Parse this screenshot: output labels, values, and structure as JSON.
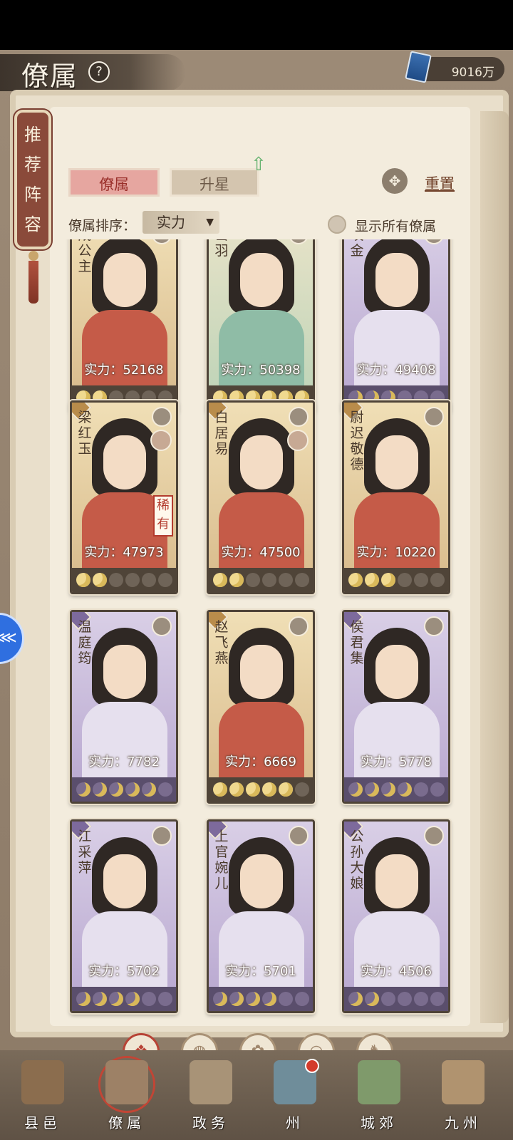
{
  "header": {
    "title": "僚属",
    "help_label": "?",
    "currency_value": "9016万",
    "currency_icon": "book-icon"
  },
  "recommend": {
    "label": "推荐阵容"
  },
  "tabs": [
    {
      "label": "僚属",
      "active": true
    },
    {
      "label": "升星",
      "active": false
    }
  ],
  "reset_label": "重置",
  "sort": {
    "label": "僚属排序：",
    "value": "实力"
  },
  "show_all_label": "显示所有僚属",
  "cards": [
    {
      "name": "成公主",
      "power_text": "实力：52168",
      "power": 52168,
      "frame": "gold",
      "stars_on": 2,
      "stars_total": 6
    },
    {
      "name": "岳羽",
      "power_text": "实力：50398",
      "power": 50398,
      "frame": "green",
      "stars_on": 6,
      "stars_total": 6
    },
    {
      "name": "咬金",
      "power_text": "实力：49408",
      "power": 49408,
      "frame": "purple",
      "stars_on": 3,
      "stars_total": 6
    },
    {
      "name": "梁红玉",
      "power_text": "实力：47973",
      "power": 47973,
      "frame": "gold",
      "stars_on": 2,
      "stars_total": 6,
      "rare": "稀有"
    },
    {
      "name": "白居易",
      "power_text": "实力：47500",
      "power": 47500,
      "frame": "gold",
      "stars_on": 2,
      "stars_total": 6
    },
    {
      "name": "尉迟敬德",
      "power_text": "实力：10220",
      "power": 10220,
      "frame": "gold",
      "stars_on": 3,
      "stars_total": 6
    },
    {
      "name": "温庭筠",
      "power_text": "实力：7782",
      "power": 7782,
      "frame": "purple",
      "stars_on": 5,
      "stars_total": 6
    },
    {
      "name": "赵飞燕",
      "power_text": "实力：6669",
      "power": 6669,
      "frame": "gold",
      "stars_on": 5,
      "stars_total": 6
    },
    {
      "name": "侯君集",
      "power_text": "实力：5778",
      "power": 5778,
      "frame": "purple",
      "stars_on": 4,
      "stars_total": 6
    },
    {
      "name": "江采萍",
      "power_text": "实力：5702",
      "power": 5702,
      "frame": "purple",
      "stars_on": 4,
      "stars_total": 6
    },
    {
      "name": "上官婉儿",
      "power_text": "实力：5701",
      "power": 5701,
      "frame": "purple",
      "stars_on": 4,
      "stars_total": 6
    },
    {
      "name": "公孙大娘",
      "power_text": "实力：4506",
      "power": 4506,
      "frame": "purple",
      "stars_on": 2,
      "stars_total": 6
    }
  ],
  "filters": [
    {
      "icon": "all-filter-icon",
      "glyph": "❖",
      "active": true
    },
    {
      "icon": "civil-filter-icon",
      "glyph": "◍",
      "active": false
    },
    {
      "icon": "gourd-filter-icon",
      "glyph": "✿",
      "active": false
    },
    {
      "icon": "fan-filter-icon",
      "glyph": "◠",
      "active": false
    },
    {
      "icon": "beast-filter-icon",
      "glyph": "♞",
      "active": false
    }
  ],
  "bottom_nav": [
    {
      "label": "县邑",
      "icon": "county-icon",
      "active": false
    },
    {
      "label": "僚属",
      "icon": "retinue-icon",
      "active": true
    },
    {
      "label": "政务",
      "icon": "affairs-icon",
      "active": false
    },
    {
      "label": "州",
      "icon": "prefecture-icon",
      "active": false,
      "badge": true
    },
    {
      "label": "城郊",
      "icon": "suburb-icon",
      "active": false
    },
    {
      "label": "九州",
      "icon": "nine-provinces-icon",
      "active": false
    }
  ],
  "colors": {
    "gold_frame": "#d7b98a",
    "purple_frame": "#b7a6cf",
    "accent_red": "#b74336"
  }
}
